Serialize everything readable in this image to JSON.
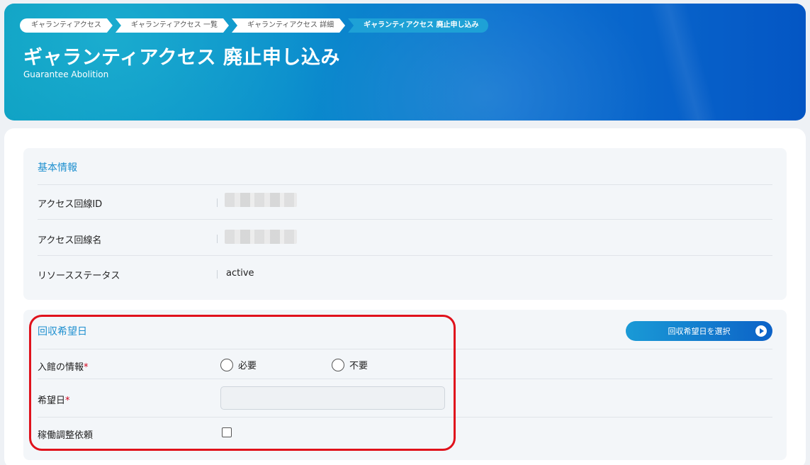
{
  "breadcrumb": [
    {
      "label": "ギャランティアクセス"
    },
    {
      "label": "ギャランティアクセス 一覧"
    },
    {
      "label": "ギャランティアクセス 詳細"
    },
    {
      "label": "ギャランティアクセス 廃止申し込み"
    }
  ],
  "header": {
    "title": "ギャランティアクセス 廃止申し込み",
    "subtitle": "Guarantee Abolition"
  },
  "basic_info": {
    "title": "基本情報",
    "rows": [
      {
        "label": "アクセス回線ID",
        "value": ""
      },
      {
        "label": "アクセス回線名",
        "value": ""
      },
      {
        "label": "リソースステータス",
        "value": "active"
      }
    ]
  },
  "collection": {
    "title": "回収希望日",
    "select_button": "回収希望日を選択",
    "entry_label": "入館の情報",
    "options": [
      {
        "label": "必要"
      },
      {
        "label": "不要"
      }
    ],
    "date_label": "希望日",
    "date_value": "",
    "adjust_label": "稼働調整依頼",
    "required_mark": "*"
  },
  "colors": {
    "accent": "#1d8fcf",
    "required": "#d0021b",
    "highlight": "#e0121c"
  }
}
